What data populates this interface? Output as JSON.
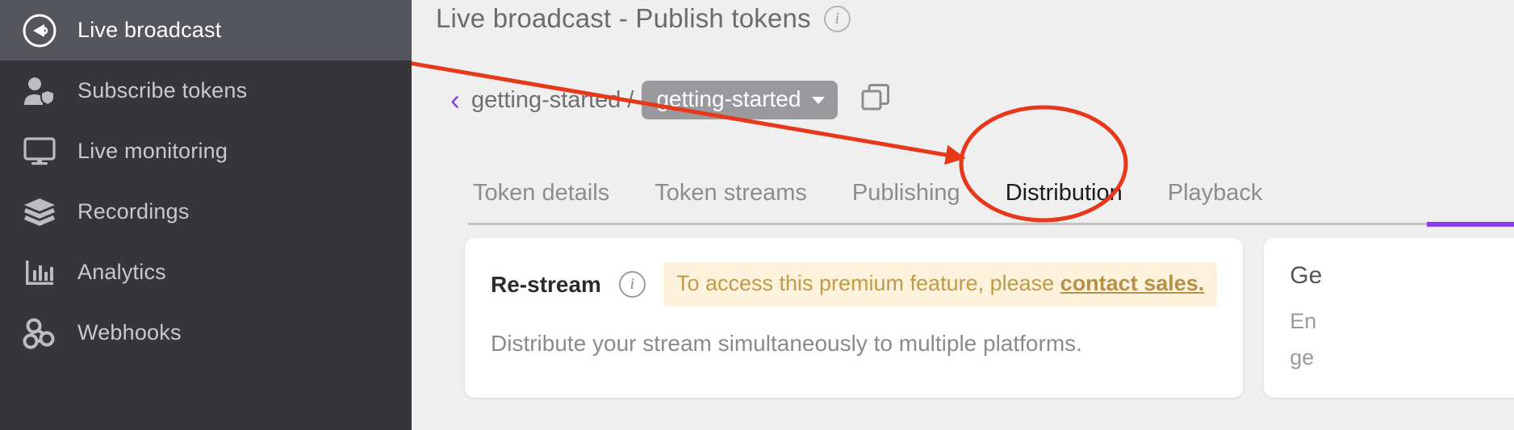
{
  "sidebar": {
    "items": [
      {
        "label": "Live broadcast",
        "icon": "broadcast-icon",
        "active": true
      },
      {
        "label": "Subscribe tokens",
        "icon": "user-shield-icon",
        "active": false
      },
      {
        "label": "Live monitoring",
        "icon": "monitor-icon",
        "active": false
      },
      {
        "label": "Recordings",
        "icon": "layers-icon",
        "active": false
      },
      {
        "label": "Analytics",
        "icon": "bar-chart-icon",
        "active": false
      },
      {
        "label": "Webhooks",
        "icon": "webhook-icon",
        "active": false
      }
    ]
  },
  "header": {
    "title": "Live broadcast - Publish tokens",
    "info_icon": "info-icon"
  },
  "breadcrumb": {
    "back_icon": "chevron-left-icon",
    "root": "getting-started",
    "separator": "/",
    "selected": "getting-started",
    "caret_icon": "chevron-down-icon",
    "copy_icon": "copy-icon"
  },
  "tabs": {
    "items": [
      {
        "label": "Token details",
        "active": false
      },
      {
        "label": "Token streams",
        "active": false
      },
      {
        "label": "Publishing",
        "active": false
      },
      {
        "label": "Distribution",
        "active": true
      },
      {
        "label": "Playback",
        "active": false
      }
    ]
  },
  "restream_card": {
    "title": "Re-stream",
    "info_icon": "info-icon",
    "banner_text": "To access this premium feature, please ",
    "banner_link": "contact sales.",
    "description": "Distribute your stream simultaneously to multiple platforms."
  },
  "side_card": {
    "title": "Ge",
    "line1": "En",
    "line2": "ge"
  },
  "colors": {
    "accent_purple": "#8b3dec",
    "sidebar_bg": "#35353a",
    "sidebar_active_bg": "#55555c",
    "page_bg": "#efefef",
    "annotation_red": "#e8381b",
    "banner_bg": "#fdf3dc",
    "banner_text": "#c19a4b"
  },
  "annotations": {
    "arrow": "red-arrow-pointing-to-distribution-tab",
    "ellipse": "red-ellipse-around-distribution-tab"
  }
}
